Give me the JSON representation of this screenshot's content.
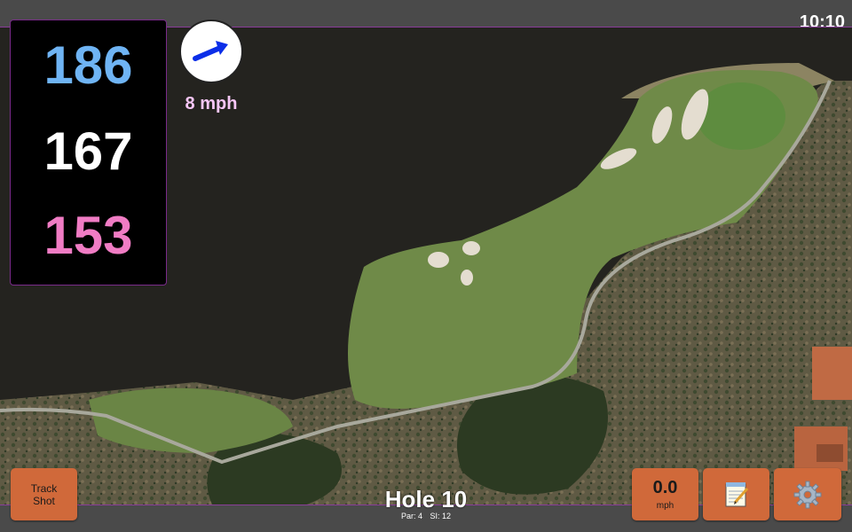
{
  "clock": "10:10",
  "yardages": {
    "back": "186",
    "middle": "167",
    "front": "153"
  },
  "colors": {
    "back": "#6fb4f4",
    "middle": "#ffffff",
    "front": "#f07cc4",
    "button": "#d0693a",
    "wind_text": "#f6c6f6"
  },
  "wind": {
    "speed_label": "8 mph",
    "arrow_icon": "wind-direction-arrow-icon"
  },
  "buttons": {
    "track_shot": "Track\nShot",
    "speed_value": "0.0",
    "speed_unit": "mph",
    "notes_icon": "notepad-icon",
    "settings_icon": "gear-icon"
  },
  "hole": {
    "title": "Hole 10",
    "par": "Par: 4",
    "si": "SI: 12"
  }
}
